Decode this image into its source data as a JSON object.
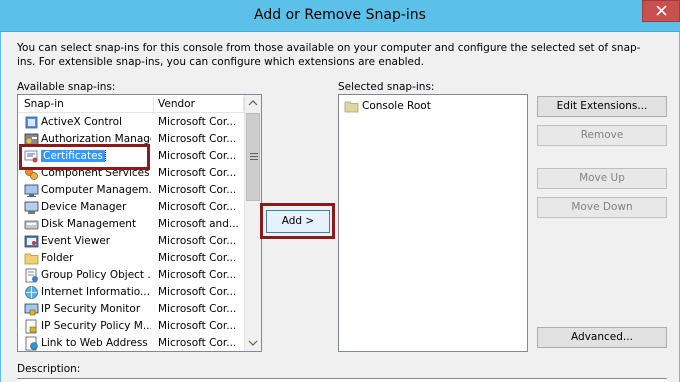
{
  "window": {
    "title": "Add or Remove Snap-ins"
  },
  "intro_text": "You can select snap-ins for this console from those available on your computer and configure the selected set of snap-ins. For extensible snap-ins, you can configure which extensions are enabled.",
  "available": {
    "label": "Available snap-ins:",
    "columns": [
      "Snap-in",
      "Vendor"
    ],
    "rows": [
      {
        "name": "ActiveX Control",
        "vendor": "Microsoft Cor...",
        "icon": "activex-icon"
      },
      {
        "name": "Authorization Manager",
        "vendor": "Microsoft Cor...",
        "icon": "authorization-icon"
      },
      {
        "name": "Certificates",
        "vendor": "Microsoft Cor...",
        "icon": "certificate-icon",
        "selected": true
      },
      {
        "name": "Component Services",
        "vendor": "Microsoft Cor...",
        "icon": "component-services-icon"
      },
      {
        "name": "Computer Managem...",
        "vendor": "Microsoft Cor...",
        "icon": "computer-management-icon"
      },
      {
        "name": "Device Manager",
        "vendor": "Microsoft Cor...",
        "icon": "device-manager-icon"
      },
      {
        "name": "Disk Management",
        "vendor": "Microsoft and...",
        "icon": "disk-icon"
      },
      {
        "name": "Event Viewer",
        "vendor": "Microsoft Cor...",
        "icon": "event-viewer-icon"
      },
      {
        "name": "Folder",
        "vendor": "Microsoft Cor...",
        "icon": "folder-icon"
      },
      {
        "name": "Group Policy Object ...",
        "vendor": "Microsoft Cor...",
        "icon": "group-policy-icon"
      },
      {
        "name": "Internet Informatio...",
        "vendor": "Microsoft Cor...",
        "icon": "iis-icon"
      },
      {
        "name": "IP Security Monitor",
        "vendor": "Microsoft Cor...",
        "icon": "ip-security-icon"
      },
      {
        "name": "IP Security Policy M...",
        "vendor": "Microsoft Cor...",
        "icon": "ip-security-policy-icon"
      },
      {
        "name": "Link to Web Address",
        "vendor": "Microsoft Cor...",
        "icon": "web-link-icon"
      }
    ]
  },
  "add_button": "Add >",
  "selected": {
    "label": "Selected snap-ins:",
    "items": [
      "Console Root"
    ]
  },
  "buttons": {
    "edit_extensions": "Edit Extensions...",
    "remove": "Remove",
    "move_up": "Move Up",
    "move_down": "Move Down",
    "advanced": "Advanced..."
  },
  "description_label": "Description:",
  "colors": {
    "titlebar": "#5bc1e8",
    "highlight": "#8b1a1a",
    "selection": "#3399ff"
  }
}
